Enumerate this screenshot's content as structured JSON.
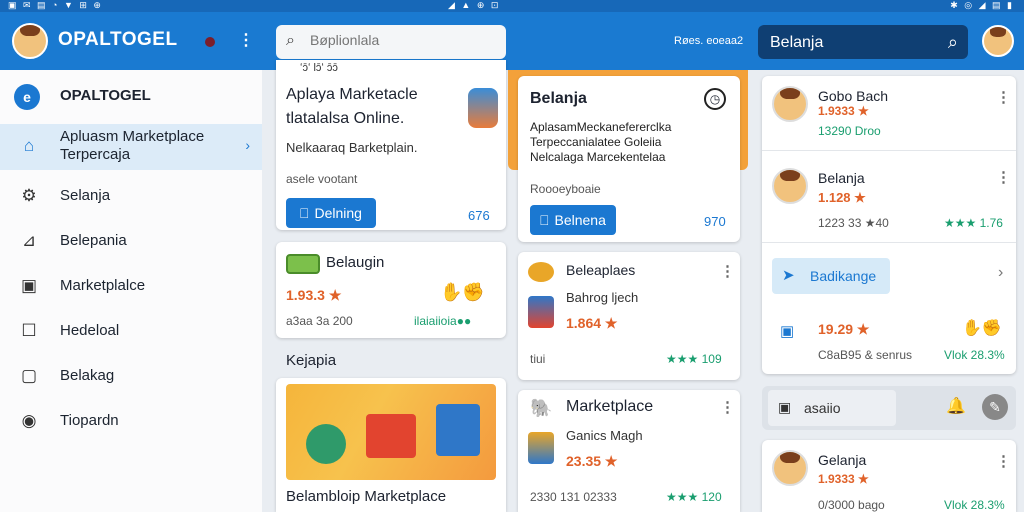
{
  "status": {
    "left": "▣ ✉ ▤ ◔ ▼ ⊞ ⊕",
    "middle": "◢ ▲ ⊕ ⊡",
    "right": "✱ ◎ ◢ ▤ ▮"
  },
  "header": {
    "brand": "OPALTOGEL",
    "search_placeholder": "Bøplionlala",
    "meta": "Røes. eoeaa2",
    "right_search": "Belanja"
  },
  "sidebar": {
    "title": "OPALTOGEL",
    "items": [
      {
        "label": "Apluasm Marketplace Terpercaja",
        "icon": "home-icon"
      },
      {
        "label": "Selanja",
        "icon": "gear-icon"
      },
      {
        "label": "Belepania",
        "icon": "bag-icon"
      },
      {
        "label": "Marketplalce",
        "icon": "store-icon"
      },
      {
        "label": "Hedeloal",
        "icon": "box-icon"
      },
      {
        "label": "Belakag",
        "icon": "square-icon"
      },
      {
        "label": "Tiopardn",
        "icon": "record-icon"
      }
    ]
  },
  "col1": {
    "hero": {
      "top": "ʻɔ̄ʻ Ɩɔ̄ʻ ɔ̄ɔ̄",
      "title1": "Aplaya Marketacle",
      "title2": "tlatalalsa Online.",
      "desc": "Nelkaaraq Barketplain.",
      "meta": "asele vootant",
      "button": "Delning",
      "count": "676"
    },
    "item": {
      "title": "Belaugin",
      "price": "1.93.3 ★",
      "meta": "a3aa 3a 200",
      "meta2": "ilaiaiioia●●"
    },
    "section": "Kejapia",
    "banner_title": "Belambloip Marketplace"
  },
  "col2": {
    "featured": {
      "title": "Belanja",
      "line1": "AplasamMeckanefererclka",
      "line2": "Terpeccanialatee Goleiia",
      "line3": "Nelcalaga Marcekentelaa",
      "meta": "Roooeyboaie",
      "button": "Belnena",
      "count": "970"
    },
    "item1": {
      "title": "Beleaplaes",
      "subtitle": "Bahrog ljech",
      "price": "1.864 ★",
      "meta": "tiui",
      "rating": "★★★ 109"
    },
    "item2": {
      "title": "Marketplace",
      "subtitle": "Ganics Magh",
      "price": "23.35 ★",
      "meta": "2330 131 02333",
      "rating": "★★★ 120"
    }
  },
  "col3": {
    "user1": {
      "name": "Gobo Bach",
      "price": "1.9333 ★",
      "meta": "13290 Droo"
    },
    "user2": {
      "name": "Belanja",
      "price": "1.128 ★",
      "meta": "1223 33 ★40",
      "rating": "★★★ 1.76"
    },
    "chip": "Badikange",
    "item3": {
      "price": "19.29 ★",
      "meta": "C8aB95 & senrus",
      "rating": "Vlok 28.3%"
    },
    "search_chip": "asaiio",
    "user3": {
      "name": "Gelanja",
      "price": "1.9333 ★",
      "meta": "0/3000 bago",
      "rating": "Vlok 28.3%"
    }
  }
}
